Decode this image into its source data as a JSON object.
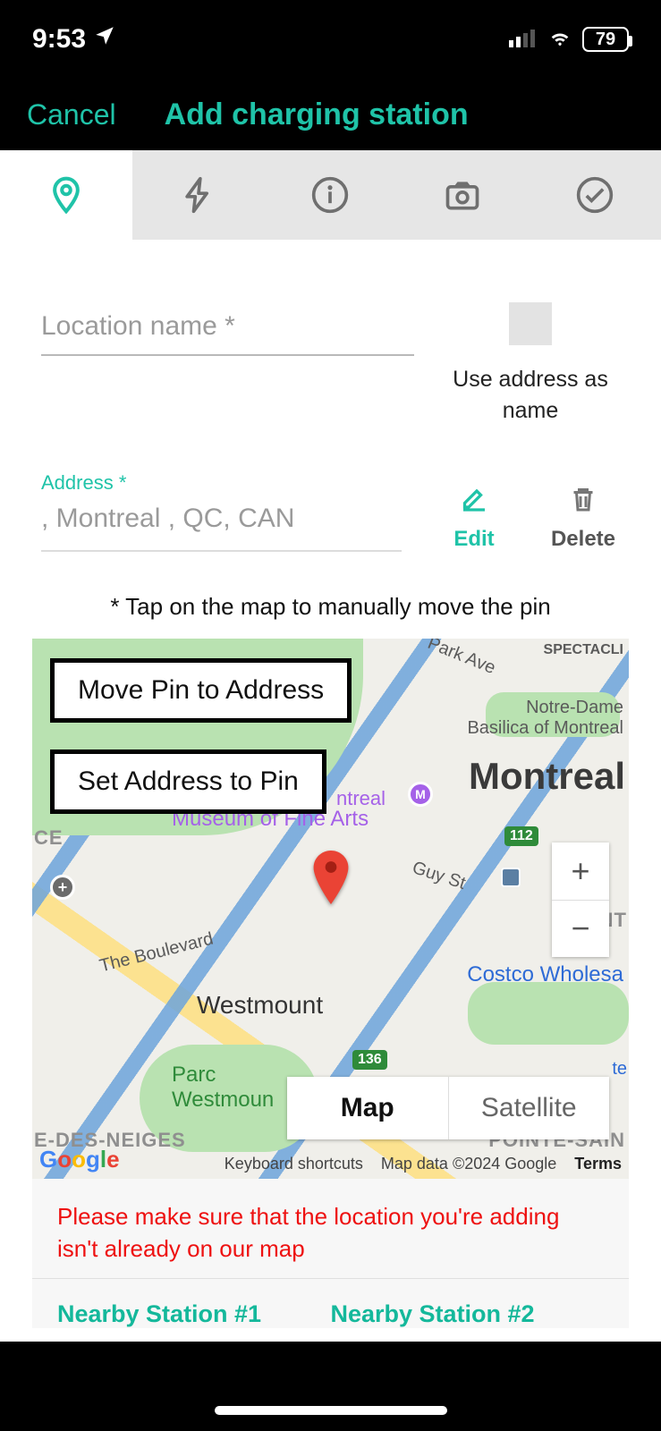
{
  "status": {
    "time": "9:53",
    "battery_pct": "79"
  },
  "nav": {
    "cancel": "Cancel",
    "title": "Add charging station"
  },
  "form": {
    "location_name_placeholder": "Location name *",
    "use_address_as_name": "Use address as name",
    "address_label": "Address *",
    "address_value": ", Montreal , QC, CAN",
    "edit": "Edit",
    "delete": "Delete",
    "map_hint": "* Tap on the map to manually move the pin"
  },
  "map": {
    "move_pin_to_address": "Move Pin to Address",
    "set_address_to_pin": "Set Address to Pin",
    "type_map": "Map",
    "type_satellite": "Satellite",
    "keyboard_shortcuts": "Keyboard shortcuts",
    "map_data": "Map data ©2024 Google",
    "terms": "Terms",
    "labels": {
      "spectacle": "SPECTACLI",
      "park_ave": "Park Ave",
      "notre_dame": "Notre-Dame\nBasilica of Montreal",
      "montreal_big": "Montreal",
      "museum": "Museum of Fine Arts",
      "museum_pre": "ntreal",
      "guy": "Guy St",
      "boulevard": "The Boulevard",
      "westmount": "Westmount",
      "parc_westmount": "Parc\nWestmoun",
      "costco": "Costco Wholesa",
      "ndn": "E-DES-NEIGES",
      "pointe": "POINTE-SAIN",
      "ce": "CE",
      "nt": "NT",
      "te": "te",
      "s112": "112",
      "s136": "136"
    }
  },
  "below": {
    "warning": "Please make sure that the location you're adding isn't already on our map",
    "nearby1": "Nearby Station #1",
    "nearby2": "Nearby Station #2"
  }
}
